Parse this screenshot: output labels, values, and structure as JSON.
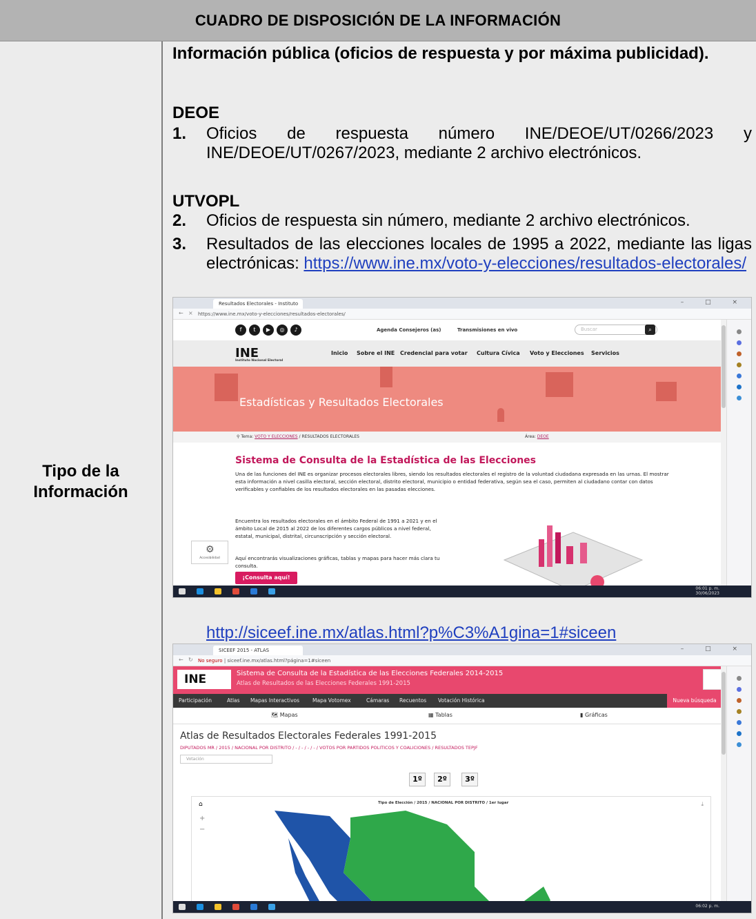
{
  "table": {
    "header": "CUADRO DE DISPOSICIÓN DE LA INFORMACIÓN",
    "left_label_line1": "Tipo de la",
    "left_label_line2": "Información"
  },
  "content": {
    "intro": "Información pública (oficios de respuesta y por máxima publicidad).",
    "deoe_heading": "DEOE",
    "item1_num": "1.",
    "item1_text": "Oficios de respuesta número INE/DEOE/UT/0266/2023 y INE/DEOE/UT/0267/2023, mediante 2 archivo electrónicos.",
    "utvopl_heading": "UTVOPL",
    "item2_num": "2.",
    "item2_text": "Oficios de respuesta sin número, mediante 2 archivo electrónicos.",
    "item3_num": "3.",
    "item3_text": "Resultados de las elecciones locales de 1995 a 2022, mediante las ligas electrónicas:",
    "link1": "https://www.ine.mx/voto-y-elecciones/resultados-electorales/",
    "link2": "http://siceef.ine.mx/atlas.html?p%C3%A1gina=1#siceen"
  },
  "shot1": {
    "tab_label": "Resultados Electorales - Instituto",
    "url": "https://www.ine.mx/voto-y-elecciones/resultados-electorales/",
    "top_links": [
      "Agenda Consejeros (as)",
      "Transmisiones en vivo"
    ],
    "search_placeholder": "Buscar",
    "logo": "INE",
    "logo_sub": "Instituto Nacional Electoral",
    "nav": [
      "Inicio",
      "Sobre el INE",
      "Credencial para votar",
      "Cultura Cívica",
      "Voto y Elecciones",
      "Servicios"
    ],
    "banner_title": "Estadísticas y Resultados Electorales",
    "crumb_tema": "Tema:",
    "crumb_link": "VOTO Y ELECCIONES",
    "crumb_rest": "/ RESULTADOS ELECTORALES",
    "crumb_area": "Área:",
    "crumb_area_link": "DEOE",
    "section_title": "Sistema de Consulta de la Estadística de las Elecciones",
    "para1": "Una de las funciones del INE es organizar procesos electorales libres, siendo los resultados electorales el registro de la voluntad ciudadana expresada en las urnas. El mostrar esta información a nivel casilla electoral, sección electoral, distrito electoral, municipio o entidad federativa, según sea el caso, permiten al ciudadano contar con datos verificables y confiables de los resultados electorales en las pasadas elecciones.",
    "para2": "Encuentra los resultados electorales en el ámbito Federal de 1991 a 2021 y en el ámbito Local de 2015 al 2022 de los diferentes cargos públicos a nivel federal, estatal, municipal, distrital, circunscripción y sección electoral.",
    "para3": "Aquí encontrarás visualizaciones gráficas, tablas y mapas para hacer más clara tu consulta.",
    "button": "¡Consulta aquí!",
    "access": "Accesibilidad",
    "time": "06:01 p. m.",
    "date": "30/06/2023"
  },
  "shot2": {
    "tab_label": "SICEEF 2015 - ATLAS",
    "url_prefix": "No seguro",
    "url": "siceef.ine.mx/atlas.html?página=1#siceen",
    "logo": "INE",
    "title": "Sistema de Consulta de la Estadística de las Elecciones Federales 2014-2015",
    "subtitle": "Atlas de Resultados de las Elecciones Federales 1991-2015",
    "nav": [
      "Participación",
      "Atlas",
      "Mapas Interactivos",
      "Mapa Votomex",
      "Cámaras",
      "Recuentos",
      "Votación Histórica"
    ],
    "nueva": "Nueva búsqueda",
    "tabs": [
      "Mapas",
      "Tablas",
      "Gráficas"
    ],
    "atlas_title": "Atlas de Resultados Electorales Federales 1991-2015",
    "crumb": "DIPUTADOS MR / 2015 / NACIONAL POR DISTRITO / - / - / - / - / VOTOS POR PARTIDOS POLITICOS Y COALICIONES / RESULTADOS TEPJF",
    "select": "Votación",
    "ranks": [
      "1º",
      "2º",
      "3º"
    ],
    "map_caption": "Tipo de Elección / 2015 / NACIONAL POR DISTRITO / 1er lugar",
    "time": "06:02 p. m."
  },
  "colors": {
    "header_bg": "#b3b3b3",
    "cell_bg": "#ececec",
    "link": "#1f3fbf",
    "ine_pink": "#c2185b",
    "banner": "#ee8a80",
    "map_green": "#2fa84a",
    "map_blue": "#1f54a8"
  }
}
